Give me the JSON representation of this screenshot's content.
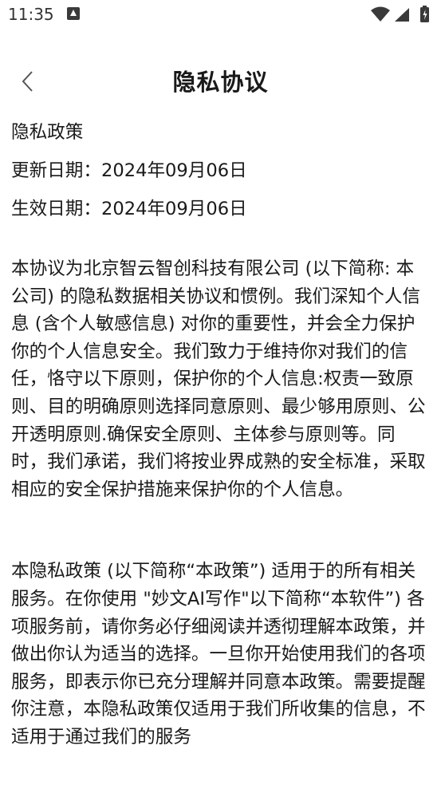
{
  "status_bar": {
    "time": "11:35",
    "icons": [
      "notification-icon",
      "wifi-icon",
      "signal-icon",
      "battery-icon"
    ]
  },
  "nav": {
    "title": "隐私协议",
    "back_icon": "chevron-left-icon"
  },
  "meta": {
    "policy_name": "隐私政策",
    "updated": "更新日期：2024年09月06日",
    "effective": "生效日期：2024年09月06日"
  },
  "paragraphs": [
    "本协议为北京智云智创科技有限公司 (以下简称: 本公司) 的隐私数据相关协议和惯例。我们深知个人信息 (含个人敏感信息) 对你的重要性，并会全力保护你的个人信息安全。我们致力于维持你对我们的信任，恪守以下原则，保护你的个人信息:权责一致原则、目的明确原则选择同意原则、最少够用原则、公开透明原则.确保安全原则、主体参与原则等。同时，我们承诺，我们将按业界成熟的安全标准，采取相应的安全保护措施来保护你的个人信息。",
    "本隐私政策 (以下简称“本政策”) 适用于的所有相关服务。在你使用 \"妙文AI写作\"以下简称“本软件”) 各项服务前，请你务必仔细阅读并透彻理解本政策，并做出你认为适当的选择。一旦你开始使用我们的各项服务，即表示你已充分理解并同意本政策。需要提醒你注意，本隐私政策仅适用于我们所收集的信息，不适用于通过我们的服务"
  ],
  "colors": {
    "background": "#ffffff",
    "text": "#1a1a1a",
    "status_icons": "#3a3a3a"
  }
}
